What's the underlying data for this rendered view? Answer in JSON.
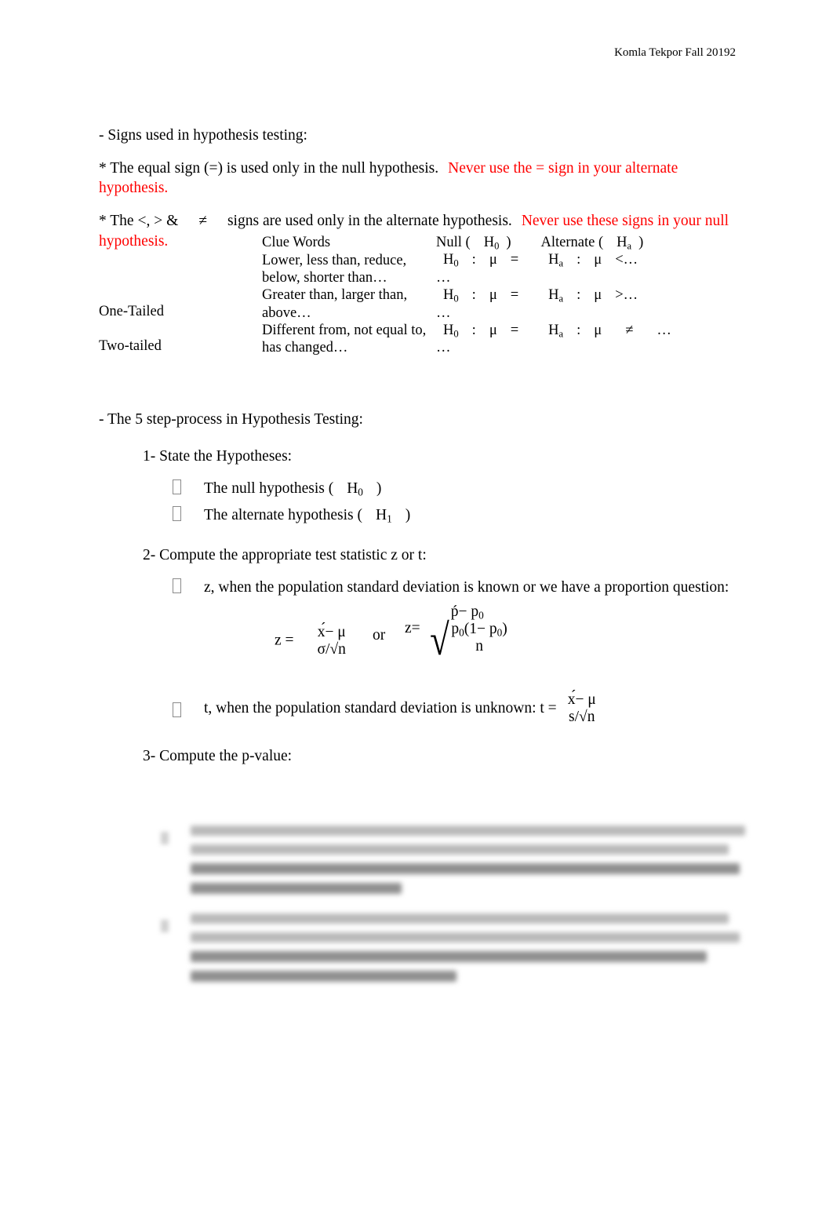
{
  "header": {
    "author_term": "Komla Tekpor Fall 20192"
  },
  "intro": {
    "line1": "- Signs used in hypothesis testing:",
    "line2_black": "* The equal sign (=) is used only in the null hypothesis.",
    "line2_red": "Never use the = sign in your alternate hypothesis.",
    "line3_black_a": "* The <, > &",
    "line3_neq": "≠",
    "line3_black_b": "signs are used only in the alternate hypothesis.",
    "line3_red": "Never use these signs in your null hypothesis."
  },
  "clue_table": {
    "headers": {
      "type": "",
      "clue": "Clue Words",
      "null_label_a": "Null (",
      "null_label_h": "H",
      "null_label_sub": "0",
      "null_label_b": ")",
      "alt_label_a": "Alternate (",
      "alt_label_h": "H",
      "alt_label_sub": "a",
      "alt_label_b": ")"
    },
    "rows": [
      {
        "type": "",
        "clue": "Lower, less than, reduce, below, shorter than…",
        "null_h": "H",
        "null_sub": "0",
        "null_colon": ":",
        "null_mu": "μ",
        "null_op": "=",
        "alt_h": "H",
        "alt_sub": "a",
        "alt_colon": ":",
        "alt_mu": "μ",
        "alt_op": "<",
        "alt_ellipsis": "…",
        "wrap_ellipsis": "…"
      },
      {
        "type": "One-Tailed",
        "clue": "Greater than, larger than, above…",
        "null_h": "H",
        "null_sub": "0",
        "null_colon": ":",
        "null_mu": "μ",
        "null_op": "=",
        "alt_h": "H",
        "alt_sub": "a",
        "alt_colon": ":",
        "alt_mu": "μ",
        "alt_op": ">",
        "alt_ellipsis": "…",
        "wrap_ellipsis": "…"
      },
      {
        "type": "Two-tailed",
        "clue": "Different from, not equal to, has changed…",
        "null_h": "H",
        "null_sub": "0",
        "null_colon": ":",
        "null_mu": "μ",
        "null_op": "=",
        "alt_h": "H",
        "alt_sub": "a",
        "alt_colon": ":",
        "alt_mu": "μ",
        "alt_op": "≠",
        "alt_ellipsis": "…",
        "wrap_ellipsis": "…"
      }
    ]
  },
  "steps": {
    "heading": "- The 5 step-process in Hypothesis Testing:",
    "step1": {
      "label": "1- State the Hypotheses:",
      "bullets": [
        {
          "text_a": "The null hypothesis (",
          "h": "H",
          "sub": "0",
          "text_b": ")"
        },
        {
          "text_a": "The alternate hypothesis (",
          "h": "H",
          "sub": "1",
          "text_b": ")"
        }
      ]
    },
    "step2": {
      "label": "2- Compute the appropriate test statistic z or t:",
      "bullet_z": "z, when the population standard deviation is known or we have a proportion question:",
      "formula_z_label": "z =",
      "formula_z_num": "х́− μ",
      "formula_z_den": "σ/√n",
      "formula_or": "or",
      "formula_p_label": "z=",
      "formula_p_num_a": "ṕ",
      "formula_p_num_b": "− p",
      "formula_p_num_sub": "0",
      "formula_p_inner_a": "p",
      "formula_p_inner_sub1": "0",
      "formula_p_inner_b": "(1− p",
      "formula_p_inner_sub2": "0",
      "formula_p_inner_c": ")",
      "formula_p_den": "n",
      "radical": "√",
      "bullet_t": "t, when the population standard deviation is unknown: t =",
      "formula_t_num": "х́− μ",
      "formula_t_den": "s/√n"
    },
    "step3": {
      "label": "3- Compute the p-value:"
    }
  },
  "redacted": {
    "note": "",
    "items": [
      {
        "lines": 4
      },
      {
        "lines": 4
      }
    ]
  }
}
